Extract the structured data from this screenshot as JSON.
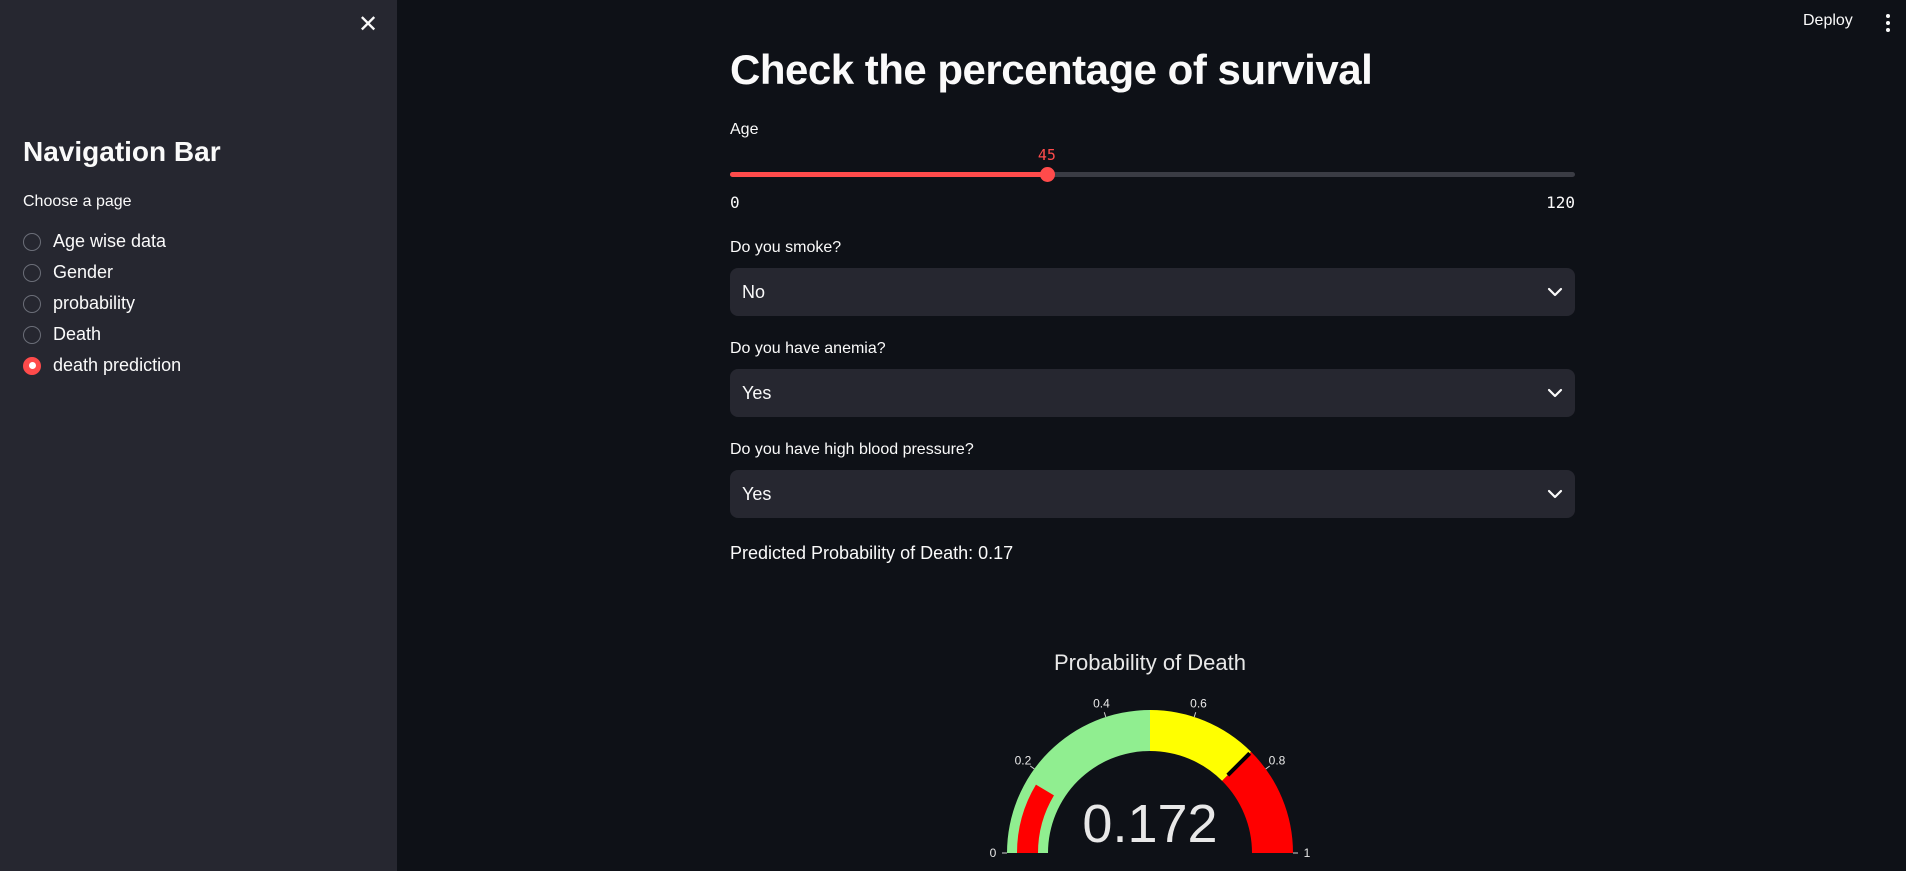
{
  "sidebar": {
    "title": "Navigation Bar",
    "radio_label": "Choose a page",
    "items": [
      {
        "label": "Age wise data",
        "checked": false
      },
      {
        "label": "Gender",
        "checked": false
      },
      {
        "label": "probability",
        "checked": false
      },
      {
        "label": "Death",
        "checked": false
      },
      {
        "label": "death prediction",
        "checked": true
      }
    ],
    "close_icon": "close-icon"
  },
  "header": {
    "deploy_label": "Deploy",
    "menu_icon": "kebab-menu-icon"
  },
  "main": {
    "title": "Check the percentage of survival",
    "age": {
      "label": "Age",
      "value": 45,
      "min": 0,
      "max": 120,
      "min_label": "0",
      "max_label": "120"
    },
    "smoke": {
      "label": "Do you smoke?",
      "value": "No"
    },
    "anemia": {
      "label": "Do you have anemia?",
      "value": "Yes"
    },
    "blood_pressure": {
      "label": "Do you have high blood pressure?",
      "value": "Yes"
    },
    "result": "Predicted Probability of Death: 0.17"
  },
  "colors": {
    "accent": "#ff4b4b",
    "background": "#0e1117",
    "sidebar": "#262730",
    "gauge_green": "#90ee90",
    "gauge_yellow": "#ffff00",
    "gauge_red": "#ff0000"
  },
  "chart_data": {
    "type": "gauge",
    "title": "Probability of Death",
    "value": 0.172,
    "value_label": "0.172",
    "range": [
      0,
      1
    ],
    "ticks": [
      0,
      0.2,
      0.4,
      0.6,
      0.8,
      1
    ],
    "tick_labels": [
      "0",
      "0.2",
      "0.4",
      "0.6",
      "0.8",
      "1"
    ],
    "steps": [
      {
        "range": [
          0,
          0.5
        ],
        "color": "#90ee90"
      },
      {
        "range": [
          0.5,
          0.75
        ],
        "color": "#ffff00"
      },
      {
        "range": [
          0.75,
          1
        ],
        "color": "#ff0000"
      }
    ],
    "threshold": 0.75
  }
}
